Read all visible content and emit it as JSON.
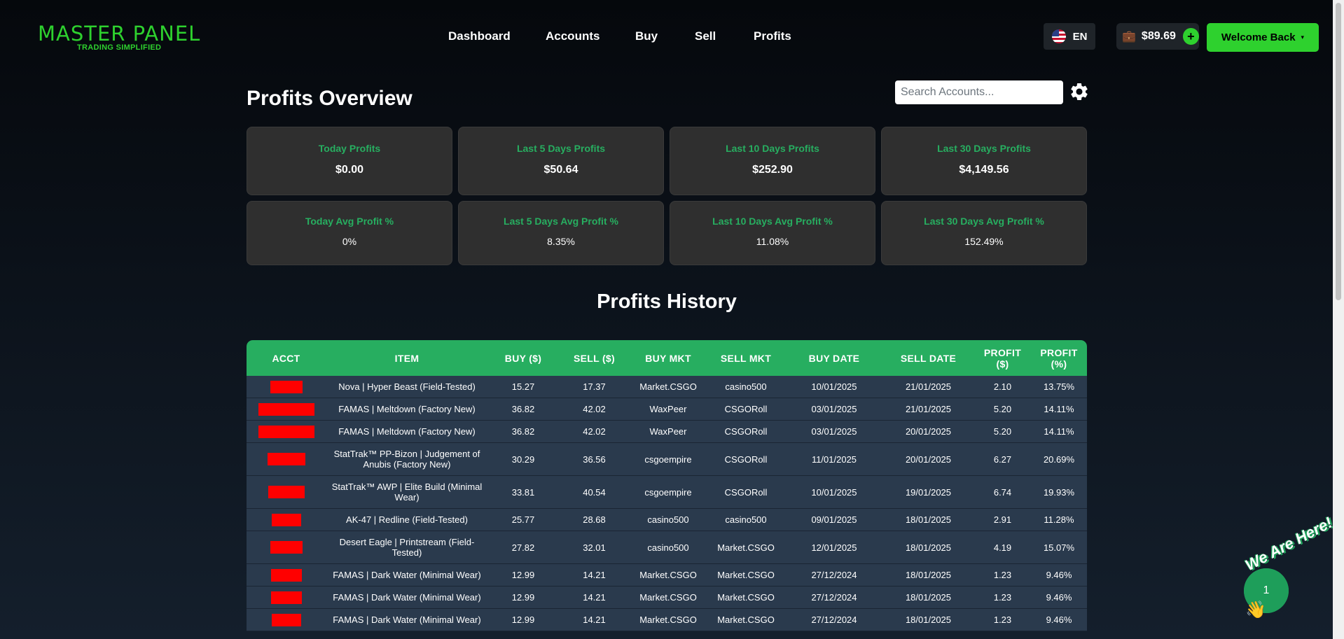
{
  "brand": {
    "name": "MASTER PANEL",
    "tagline": "TRADING SIMPLIFIED",
    "color": "#2ed12e"
  },
  "nav": [
    "Dashboard",
    "Accounts",
    "Buy",
    "Sell",
    "Profits"
  ],
  "language": {
    "code": "EN",
    "icon": "us-flag-icon"
  },
  "wallet": {
    "balance": "$89.69",
    "icon": "briefcase-icon",
    "add_label": "+"
  },
  "user_menu": {
    "label": "Welcome Back",
    "caret": "▾"
  },
  "page": {
    "title": "Profits Overview"
  },
  "search": {
    "placeholder": "Search Accounts..."
  },
  "settings": {
    "icon": "gear-icon"
  },
  "stats": [
    {
      "label": "Today Profits",
      "value": "$0.00"
    },
    {
      "label": "Last 5 Days Profits",
      "value": "$50.64"
    },
    {
      "label": "Last 10 Days Profits",
      "value": "$252.90"
    },
    {
      "label": "Last 30 Days Profits",
      "value": "$4,149.56"
    }
  ],
  "avg_stats": [
    {
      "label": "Today Avg Profit %",
      "value": "0%"
    },
    {
      "label": "Last 5 Days Avg Profit %",
      "value": "8.35%"
    },
    {
      "label": "Last 10 Days Avg Profit %",
      "value": "11.08%"
    },
    {
      "label": "Last 30 Days Avg Profit %",
      "value": "152.49%"
    }
  ],
  "history": {
    "title": "Profits History",
    "columns": [
      "ACCT",
      "ITEM",
      "BUY ($)",
      "SELL ($)",
      "BUY MKT",
      "SELL MKT",
      "BUY DATE",
      "SELL DATE",
      "PROFIT ($)",
      "PROFIT (%)"
    ],
    "rows": [
      {
        "acct": "[redacted]",
        "item": "Nova | Hyper Beast (Field-Tested)",
        "buy": "15.27",
        "sell": "17.37",
        "buy_mkt": "Market.CSGO",
        "sell_mkt": "casino500",
        "buy_date": "10/01/2025",
        "sell_date": "21/01/2025",
        "profit": "2.10",
        "profit_pct": "13.75%"
      },
      {
        "acct": "[redacted]",
        "item": "FAMAS | Meltdown (Factory New)",
        "buy": "36.82",
        "sell": "42.02",
        "buy_mkt": "WaxPeer",
        "sell_mkt": "CSGORoll",
        "buy_date": "03/01/2025",
        "sell_date": "21/01/2025",
        "profit": "5.20",
        "profit_pct": "14.11%"
      },
      {
        "acct": "[redacted]",
        "item": "FAMAS | Meltdown (Factory New)",
        "buy": "36.82",
        "sell": "42.02",
        "buy_mkt": "WaxPeer",
        "sell_mkt": "CSGORoll",
        "buy_date": "03/01/2025",
        "sell_date": "20/01/2025",
        "profit": "5.20",
        "profit_pct": "14.11%"
      },
      {
        "acct": "[redacted]",
        "item": "StatTrak™ PP-Bizon | Judgement of Anubis (Factory New)",
        "buy": "30.29",
        "sell": "36.56",
        "buy_mkt": "csgoempire",
        "sell_mkt": "CSGORoll",
        "buy_date": "11/01/2025",
        "sell_date": "20/01/2025",
        "profit": "6.27",
        "profit_pct": "20.69%"
      },
      {
        "acct": "[redacted]",
        "item": "StatTrak™ AWP | Elite Build (Minimal Wear)",
        "buy": "33.81",
        "sell": "40.54",
        "buy_mkt": "csgoempire",
        "sell_mkt": "CSGORoll",
        "buy_date": "10/01/2025",
        "sell_date": "19/01/2025",
        "profit": "6.74",
        "profit_pct": "19.93%"
      },
      {
        "acct": "[redacted]",
        "item": "AK-47 | Redline (Field-Tested)",
        "buy": "25.77",
        "sell": "28.68",
        "buy_mkt": "casino500",
        "sell_mkt": "casino500",
        "buy_date": "09/01/2025",
        "sell_date": "18/01/2025",
        "profit": "2.91",
        "profit_pct": "11.28%"
      },
      {
        "acct": "[redacted]",
        "item": "Desert Eagle | Printstream (Field-Tested)",
        "buy": "27.82",
        "sell": "32.01",
        "buy_mkt": "casino500",
        "sell_mkt": "Market.CSGO",
        "buy_date": "12/01/2025",
        "sell_date": "18/01/2025",
        "profit": "4.19",
        "profit_pct": "15.07%"
      },
      {
        "acct": "[redacted]",
        "item": "FAMAS | Dark Water (Minimal Wear)",
        "buy": "12.99",
        "sell": "14.21",
        "buy_mkt": "Market.CSGO",
        "sell_mkt": "Market.CSGO",
        "buy_date": "27/12/2024",
        "sell_date": "18/01/2025",
        "profit": "1.23",
        "profit_pct": "9.46%"
      },
      {
        "acct": "[redacted]",
        "item": "FAMAS | Dark Water (Minimal Wear)",
        "buy": "12.99",
        "sell": "14.21",
        "buy_mkt": "Market.CSGO",
        "sell_mkt": "Market.CSGO",
        "buy_date": "27/12/2024",
        "sell_date": "18/01/2025",
        "profit": "1.23",
        "profit_pct": "9.46%"
      },
      {
        "acct": "[redacted]",
        "item": "FAMAS | Dark Water (Minimal Wear)",
        "buy": "12.99",
        "sell": "14.21",
        "buy_mkt": "Market.CSGO",
        "sell_mkt": "Market.CSGO",
        "buy_date": "27/12/2024",
        "sell_date": "18/01/2025",
        "profit": "1.23",
        "profit_pct": "9.46%"
      }
    ]
  },
  "chat_widget": {
    "label": "We Are Here!",
    "badge": "1",
    "icon": "chat-bubble-icon",
    "wave_icon": "waving-hand-icon"
  }
}
